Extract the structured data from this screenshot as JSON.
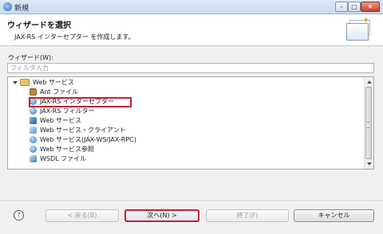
{
  "window": {
    "title": "新規"
  },
  "header": {
    "title": "ウィザードを選択",
    "description": "JAX-RS インターセプター を作成します。"
  },
  "filter": {
    "label": "ウィザード(W):",
    "placeholder": "フィルタ入力"
  },
  "tree": {
    "category": {
      "label": "Web サービス",
      "icon": "folder-icon"
    },
    "items": [
      {
        "label": "Ant ファイル",
        "icon": "ant-file-icon"
      },
      {
        "label": "JAX-RS インターセプター",
        "icon": "jaxrs-interceptor-icon",
        "highlighted": true
      },
      {
        "label": "JAX-RS フィルター",
        "icon": "jaxrs-filter-icon"
      },
      {
        "label": "Web サービス",
        "icon": "web-service-icon"
      },
      {
        "label": "Web サービス・クライアント",
        "icon": "web-service-client-icon"
      },
      {
        "label": "Web サービス(JAX-WS/JAX-RPC)",
        "icon": "jaxws-icon"
      },
      {
        "label": "Web サービス参照",
        "icon": "web-service-reference-icon"
      },
      {
        "label": "WSDL ファイル",
        "icon": "wsdl-file-icon"
      }
    ]
  },
  "buttons": {
    "help": "?",
    "back": "< 戻る(B)",
    "next": "次へ(N) >",
    "finish": "終了(F)",
    "cancel": "キャンセル"
  },
  "window_controls": {
    "minimize": "–",
    "maximize": "□",
    "close": "✕"
  },
  "colors": {
    "highlight_border": "#c3222e",
    "titlebar": "#c9dbef"
  }
}
